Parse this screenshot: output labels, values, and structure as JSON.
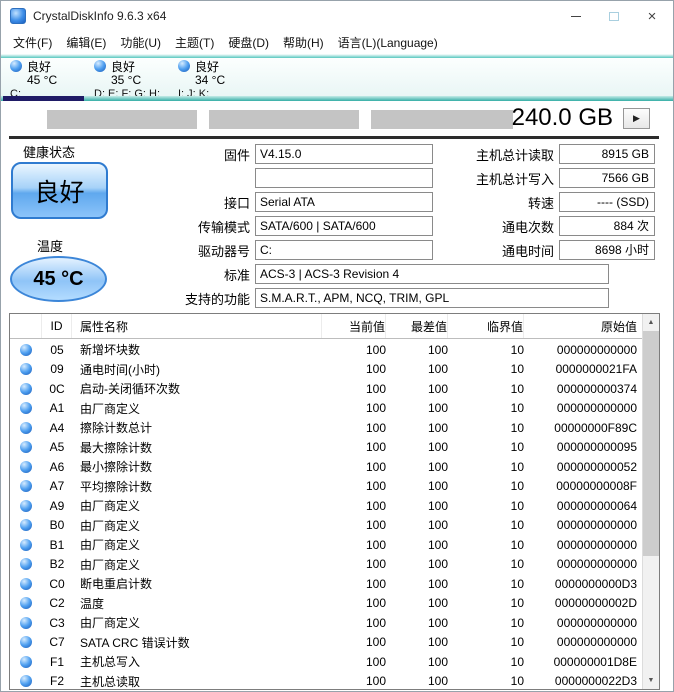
{
  "window": {
    "title": "CrystalDiskInfo 9.6.3 x64"
  },
  "menu": {
    "items": [
      "文件(F)",
      "编辑(E)",
      "功能(U)",
      "主题(T)",
      "硬盘(D)",
      "帮助(H)",
      "语言(L)(Language)"
    ]
  },
  "tabs": [
    {
      "status": "良好",
      "temp": "45 °C",
      "letters": "C:",
      "selected": true
    },
    {
      "status": "良好",
      "temp": "35 °C",
      "letters": "D: E: F: G: H:",
      "selected": false
    },
    {
      "status": "良好",
      "temp": "34 °C",
      "letters": "I: J: K:",
      "selected": false
    }
  ],
  "drive": {
    "capacity": "240.0 GB",
    "next_button": "▶",
    "health_label": "健康状态",
    "health_value": "良好",
    "temp_label": "温度",
    "temp_value": "45 °C",
    "fields": [
      {
        "label": "固件",
        "value": "V4.15.0",
        "wide": false
      },
      {
        "label": "",
        "value": "",
        "wide": false
      },
      {
        "label": "接口",
        "value": "Serial ATA",
        "wide": false
      },
      {
        "label": "传输模式",
        "value": "SATA/600 | SATA/600",
        "wide": false
      },
      {
        "label": "驱动器号",
        "value": "C:",
        "wide": false
      },
      {
        "label": "标准",
        "value": "ACS-3 | ACS-3 Revision 4",
        "wide": true
      },
      {
        "label": "支持的功能",
        "value": "S.M.A.R.T., APM, NCQ, TRIM, GPL",
        "wide": true
      }
    ],
    "stats": [
      {
        "label": "主机总计读取",
        "value": "8915 GB"
      },
      {
        "label": "主机总计写入",
        "value": "7566 GB"
      },
      {
        "label": "转速",
        "value": "---- (SSD)"
      },
      {
        "label": "通电次数",
        "value": "884 次"
      },
      {
        "label": "通电时间",
        "value": "8698 小时"
      }
    ]
  },
  "smart": {
    "headers": {
      "id": "ID",
      "name": "属性名称",
      "current": "当前值",
      "worst": "最差值",
      "threshold": "临界值",
      "raw": "原始值"
    },
    "rows": [
      {
        "id": "05",
        "name": "新增坏块数",
        "current": "100",
        "worst": "100",
        "threshold": "10",
        "raw": "000000000000"
      },
      {
        "id": "09",
        "name": "通电时间(小时)",
        "current": "100",
        "worst": "100",
        "threshold": "10",
        "raw": "0000000021FA"
      },
      {
        "id": "0C",
        "name": "启动-关闭循环次数",
        "current": "100",
        "worst": "100",
        "threshold": "10",
        "raw": "000000000374"
      },
      {
        "id": "A1",
        "name": "由厂商定义",
        "current": "100",
        "worst": "100",
        "threshold": "10",
        "raw": "000000000000"
      },
      {
        "id": "A4",
        "name": "擦除计数总计",
        "current": "100",
        "worst": "100",
        "threshold": "10",
        "raw": "00000000F89C"
      },
      {
        "id": "A5",
        "name": "最大擦除计数",
        "current": "100",
        "worst": "100",
        "threshold": "10",
        "raw": "000000000095"
      },
      {
        "id": "A6",
        "name": "最小擦除计数",
        "current": "100",
        "worst": "100",
        "threshold": "10",
        "raw": "000000000052"
      },
      {
        "id": "A7",
        "name": "平均擦除计数",
        "current": "100",
        "worst": "100",
        "threshold": "10",
        "raw": "00000000008F"
      },
      {
        "id": "A9",
        "name": "由厂商定义",
        "current": "100",
        "worst": "100",
        "threshold": "10",
        "raw": "000000000064"
      },
      {
        "id": "B0",
        "name": "由厂商定义",
        "current": "100",
        "worst": "100",
        "threshold": "10",
        "raw": "000000000000"
      },
      {
        "id": "B1",
        "name": "由厂商定义",
        "current": "100",
        "worst": "100",
        "threshold": "10",
        "raw": "000000000000"
      },
      {
        "id": "B2",
        "name": "由厂商定义",
        "current": "100",
        "worst": "100",
        "threshold": "10",
        "raw": "000000000000"
      },
      {
        "id": "C0",
        "name": "断电重启计数",
        "current": "100",
        "worst": "100",
        "threshold": "10",
        "raw": "0000000000D3"
      },
      {
        "id": "C2",
        "name": "温度",
        "current": "100",
        "worst": "100",
        "threshold": "10",
        "raw": "00000000002D"
      },
      {
        "id": "C3",
        "name": "由厂商定义",
        "current": "100",
        "worst": "100",
        "threshold": "10",
        "raw": "000000000000"
      },
      {
        "id": "C7",
        "name": "SATA CRC 错误计数",
        "current": "100",
        "worst": "100",
        "threshold": "10",
        "raw": "000000000000"
      },
      {
        "id": "F1",
        "name": "主机总写入",
        "current": "100",
        "worst": "100",
        "threshold": "10",
        "raw": "000000001D8E"
      },
      {
        "id": "F2",
        "name": "主机总读取",
        "current": "100",
        "worst": "100",
        "threshold": "10",
        "raw": "0000000022D3"
      }
    ]
  },
  "colors": {
    "accent_teal": "#35aea6",
    "selected_tab_navy": "#1f1b66",
    "health_button_blue": "#5fa8ee",
    "sphere_blue": "#2e7de0"
  }
}
